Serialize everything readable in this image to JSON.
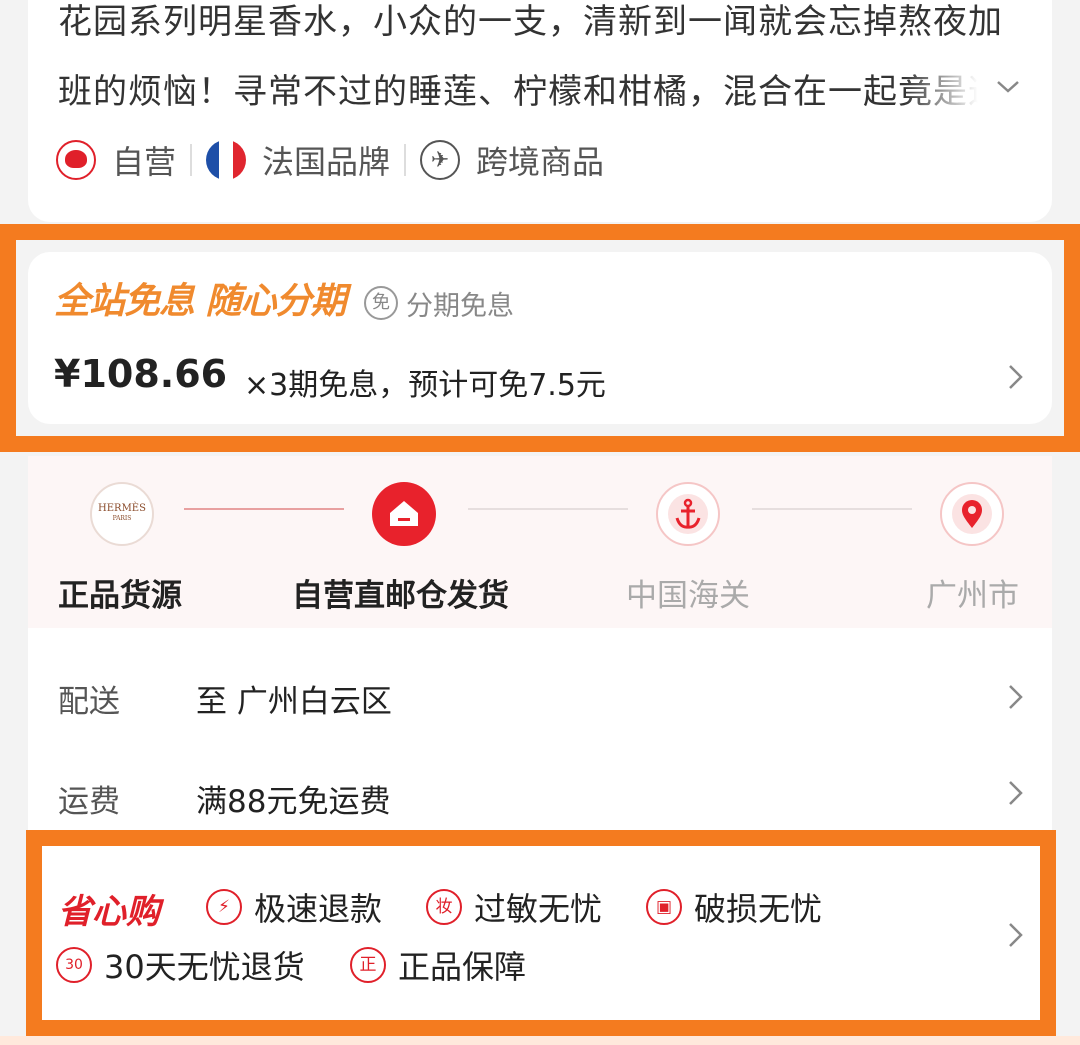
{
  "description": {
    "line1": "花园系列明星香水，小众的一支，清新到一闻就会忘掉熬夜加",
    "line2": "班的烦恼！寻常不过的睡莲、柠檬和柑橘，混合在一起竟是这"
  },
  "tags": [
    {
      "label": "自营",
      "icon": "self-operated-icon"
    },
    {
      "label": "法国品牌",
      "icon": "france-flag-icon"
    },
    {
      "label": "跨境商品",
      "icon": "plane-icon"
    }
  ],
  "installment": {
    "promo": "全站免息 随心分期",
    "badge": "免",
    "subtitle": "分期免息",
    "price": "¥108.66",
    "detail": "×3期免息，预计可免7.5元"
  },
  "track": {
    "brand_logo_text": "HERMÈS",
    "brand_logo_sub": "PARIS",
    "steps": [
      {
        "label": "正品货源",
        "icon": "hermes-logo-icon",
        "active": true
      },
      {
        "label": "自营直邮仓发货",
        "icon": "house-icon",
        "active": true
      },
      {
        "label": "中国海关",
        "icon": "anchor-icon",
        "active": false
      },
      {
        "label": "广州市",
        "icon": "location-pin-icon",
        "active": false
      }
    ]
  },
  "shipping": {
    "delivery_label": "配送",
    "delivery_value": "至 广州白云区",
    "fee_label": "运费",
    "fee_value": "满88元免运费"
  },
  "worry_free": {
    "title": "省心购",
    "services": [
      {
        "label": "极速退款",
        "icon_glyph": "⚡"
      },
      {
        "label": "过敏无忧",
        "icon_glyph": "妆"
      },
      {
        "label": "破损无忧",
        "icon_glyph": "▣"
      },
      {
        "label": "30天无忧退货",
        "icon_glyph": "30"
      },
      {
        "label": "正品保障",
        "icon_glyph": "正"
      }
    ]
  },
  "colors": {
    "highlight_frame": "#f47b1f",
    "accent_red": "#e0202a",
    "promo_orange": "#f08a2e"
  }
}
